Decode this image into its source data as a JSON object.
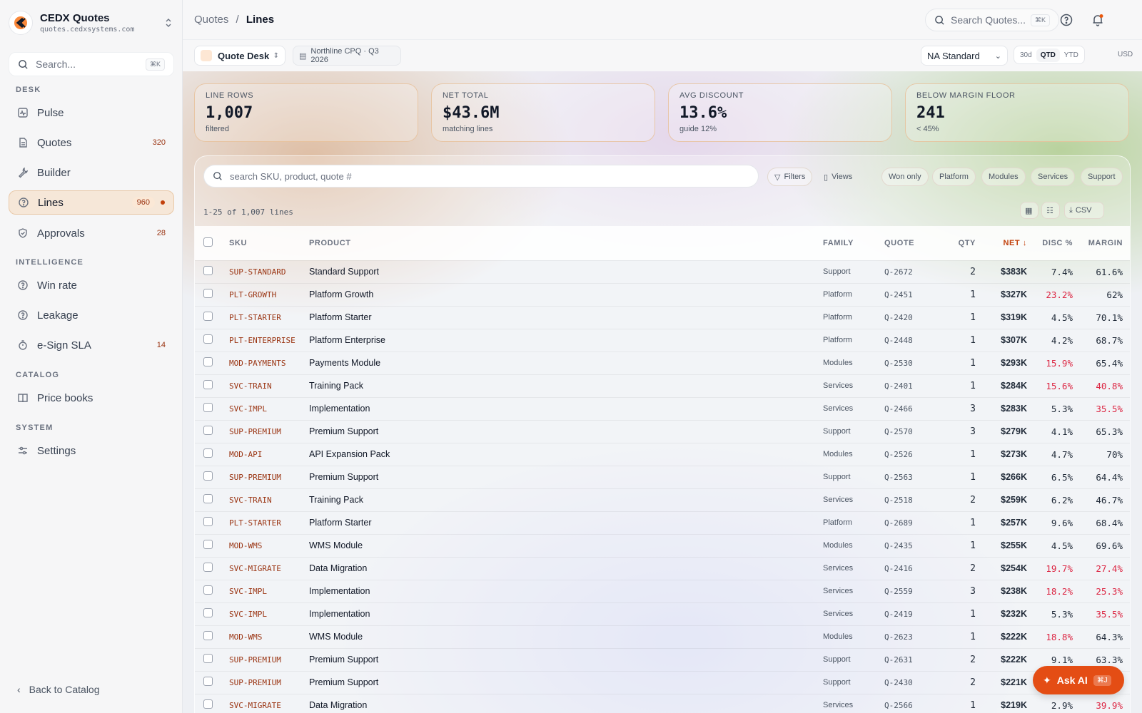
{
  "app": {
    "name": "CEDX Quotes",
    "url": "quotes.cedxsystems.com"
  },
  "sidebar": {
    "search_placeholder": "Search...",
    "search_kbd": "⌘K",
    "sections": {
      "desk": "DESK",
      "intelligence": "INTELLIGENCE",
      "catalog": "CATALOG",
      "system": "SYSTEM"
    },
    "items": [
      {
        "label": "Pulse",
        "icon": "pulse-icon"
      },
      {
        "label": "Quotes",
        "count": "320",
        "icon": "document-icon"
      },
      {
        "label": "Builder",
        "icon": "wrench-icon"
      },
      {
        "label": "Lines",
        "count": "960",
        "icon": "help-circle-icon",
        "active": true
      },
      {
        "label": "Approvals",
        "count": "28",
        "icon": "shield-check-icon"
      },
      {
        "label": "Win rate",
        "icon": "help-circle-icon"
      },
      {
        "label": "Leakage",
        "icon": "help-circle-icon"
      },
      {
        "label": "e-Sign SLA",
        "count": "14",
        "icon": "timer-icon"
      },
      {
        "label": "Price books",
        "icon": "book-icon"
      },
      {
        "label": "Settings",
        "icon": "sliders-icon"
      }
    ],
    "back_label": "Back to Catalog"
  },
  "topbar": {
    "breadcrumb_parent": "Quotes",
    "breadcrumb_sep": "/",
    "breadcrumb_current": "Lines",
    "search_placeholder": "Search Quotes...",
    "search_kbd": "⌘K"
  },
  "subbar": {
    "workspace": "Quote Desk",
    "context": "Northline CPQ · Q3 2026",
    "price_book": "NA Standard",
    "ranges": [
      "30d",
      "QTD",
      "YTD"
    ],
    "active_range": "QTD",
    "currency": "USD"
  },
  "kpis": [
    {
      "label": "LINE ROWS",
      "value": "1,007",
      "sub": "filtered"
    },
    {
      "label": "NET TOTAL",
      "value": "$43.6M",
      "sub": "matching lines"
    },
    {
      "label": "AVG DISCOUNT",
      "value": "13.6%",
      "sub": "guide 12%"
    },
    {
      "label": "BELOW MARGIN FLOOR",
      "value": "241",
      "sub": "< 45%"
    }
  ],
  "table": {
    "search_placeholder": "search SKU, product, quote #",
    "filters_label": "Filters",
    "views_label": "Views",
    "chips": [
      "Won only",
      "Platform",
      "Modules",
      "Services",
      "Support"
    ],
    "row_count": "1-25 of 1,007 lines",
    "csv_label": "CSV",
    "headers": {
      "sku": "SKU",
      "product": "PRODUCT",
      "family": "FAMILY",
      "quote": "QUOTE",
      "qty": "QTY",
      "net": "NET ↓",
      "disc": "DISC %",
      "margin": "MARGIN"
    },
    "rows": [
      {
        "sku": "SUP-STANDARD",
        "product": "Standard Support",
        "family": "Support",
        "quote": "Q-2672",
        "qty": "2",
        "net": "$383K",
        "disc": "7.4%",
        "margin": "61.6%",
        "disc_flag": false,
        "margin_flag": false
      },
      {
        "sku": "PLT-GROWTH",
        "product": "Platform Growth",
        "family": "Platform",
        "quote": "Q-2451",
        "qty": "1",
        "net": "$327K",
        "disc": "23.2%",
        "margin": "62%",
        "disc_flag": true,
        "margin_flag": false
      },
      {
        "sku": "PLT-STARTER",
        "product": "Platform Starter",
        "family": "Platform",
        "quote": "Q-2420",
        "qty": "1",
        "net": "$319K",
        "disc": "4.5%",
        "margin": "70.1%",
        "disc_flag": false,
        "margin_flag": false
      },
      {
        "sku": "PLT-ENTERPRISE",
        "product": "Platform Enterprise",
        "family": "Platform",
        "quote": "Q-2448",
        "qty": "1",
        "net": "$307K",
        "disc": "4.2%",
        "margin": "68.7%",
        "disc_flag": false,
        "margin_flag": false
      },
      {
        "sku": "MOD-PAYMENTS",
        "product": "Payments Module",
        "family": "Modules",
        "quote": "Q-2530",
        "qty": "1",
        "net": "$293K",
        "disc": "15.9%",
        "margin": "65.4%",
        "disc_flag": true,
        "margin_flag": false
      },
      {
        "sku": "SVC-TRAIN",
        "product": "Training Pack",
        "family": "Services",
        "quote": "Q-2401",
        "qty": "1",
        "net": "$284K",
        "disc": "15.6%",
        "margin": "40.8%",
        "disc_flag": true,
        "margin_flag": true
      },
      {
        "sku": "SVC-IMPL",
        "product": "Implementation",
        "family": "Services",
        "quote": "Q-2466",
        "qty": "3",
        "net": "$283K",
        "disc": "5.3%",
        "margin": "35.5%",
        "disc_flag": false,
        "margin_flag": true
      },
      {
        "sku": "SUP-PREMIUM",
        "product": "Premium Support",
        "family": "Support",
        "quote": "Q-2570",
        "qty": "3",
        "net": "$279K",
        "disc": "4.1%",
        "margin": "65.3%",
        "disc_flag": false,
        "margin_flag": false
      },
      {
        "sku": "MOD-API",
        "product": "API Expansion Pack",
        "family": "Modules",
        "quote": "Q-2526",
        "qty": "1",
        "net": "$273K",
        "disc": "4.7%",
        "margin": "70%",
        "disc_flag": false,
        "margin_flag": false
      },
      {
        "sku": "SUP-PREMIUM",
        "product": "Premium Support",
        "family": "Support",
        "quote": "Q-2563",
        "qty": "1",
        "net": "$266K",
        "disc": "6.5%",
        "margin": "64.4%",
        "disc_flag": false,
        "margin_flag": false
      },
      {
        "sku": "SVC-TRAIN",
        "product": "Training Pack",
        "family": "Services",
        "quote": "Q-2518",
        "qty": "2",
        "net": "$259K",
        "disc": "6.2%",
        "margin": "46.7%",
        "disc_flag": false,
        "margin_flag": false
      },
      {
        "sku": "PLT-STARTER",
        "product": "Platform Starter",
        "family": "Platform",
        "quote": "Q-2689",
        "qty": "1",
        "net": "$257K",
        "disc": "9.6%",
        "margin": "68.4%",
        "disc_flag": false,
        "margin_flag": false
      },
      {
        "sku": "MOD-WMS",
        "product": "WMS Module",
        "family": "Modules",
        "quote": "Q-2435",
        "qty": "1",
        "net": "$255K",
        "disc": "4.5%",
        "margin": "69.6%",
        "disc_flag": false,
        "margin_flag": false
      },
      {
        "sku": "SVC-MIGRATE",
        "product": "Data Migration",
        "family": "Services",
        "quote": "Q-2416",
        "qty": "2",
        "net": "$254K",
        "disc": "19.7%",
        "margin": "27.4%",
        "disc_flag": true,
        "margin_flag": true
      },
      {
        "sku": "SVC-IMPL",
        "product": "Implementation",
        "family": "Services",
        "quote": "Q-2559",
        "qty": "3",
        "net": "$238K",
        "disc": "18.2%",
        "margin": "25.3%",
        "disc_flag": true,
        "margin_flag": true
      },
      {
        "sku": "SVC-IMPL",
        "product": "Implementation",
        "family": "Services",
        "quote": "Q-2419",
        "qty": "1",
        "net": "$232K",
        "disc": "5.3%",
        "margin": "35.5%",
        "disc_flag": false,
        "margin_flag": true
      },
      {
        "sku": "MOD-WMS",
        "product": "WMS Module",
        "family": "Modules",
        "quote": "Q-2623",
        "qty": "1",
        "net": "$222K",
        "disc": "18.8%",
        "margin": "64.3%",
        "disc_flag": true,
        "margin_flag": false
      },
      {
        "sku": "SUP-PREMIUM",
        "product": "Premium Support",
        "family": "Support",
        "quote": "Q-2631",
        "qty": "2",
        "net": "$222K",
        "disc": "9.1%",
        "margin": "63.3%",
        "disc_flag": false,
        "margin_flag": false
      },
      {
        "sku": "SUP-PREMIUM",
        "product": "Premium Support",
        "family": "Support",
        "quote": "Q-2430",
        "qty": "2",
        "net": "$221K",
        "disc": "",
        "margin": "",
        "disc_flag": false,
        "margin_flag": false
      },
      {
        "sku": "SVC-MIGRATE",
        "product": "Data Migration",
        "family": "Services",
        "quote": "Q-2566",
        "qty": "1",
        "net": "$219K",
        "disc": "2.9%",
        "margin": "39.9%",
        "disc_flag": false,
        "margin_flag": true
      }
    ]
  },
  "ask_ai": {
    "label": "Ask AI",
    "kbd": "⌘J"
  },
  "colors": {
    "accent": "#c2410c",
    "negative": "#dc2643",
    "sku": "#9a3412"
  }
}
